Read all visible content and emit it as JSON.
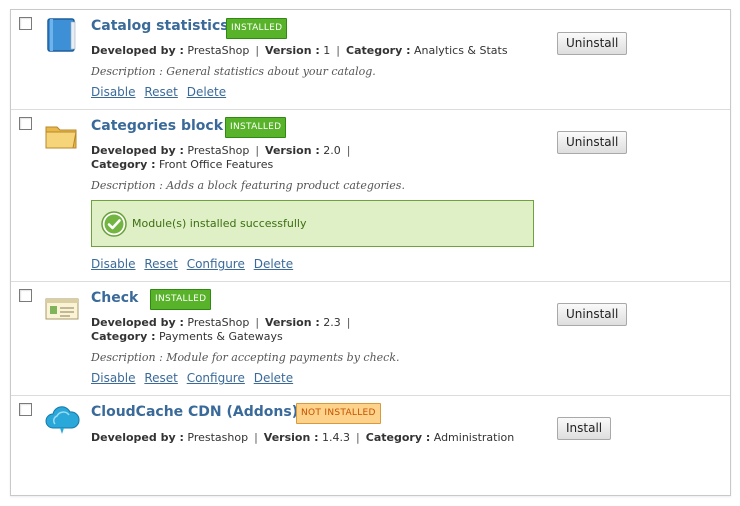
{
  "modules": [
    {
      "name": "Catalog statistics",
      "status": "INSTALLED",
      "developed_by_label": "Developed by :",
      "developer": "PrestaShop",
      "version_label": "Version :",
      "version": "1",
      "category_label": "Category :",
      "category": "Analytics & Stats",
      "description": "Description : General statistics about your catalog.",
      "actions": [
        "Disable",
        "Reset",
        "Delete"
      ],
      "button": "Uninstall",
      "icon": "blue-book-icon"
    },
    {
      "name": "Categories block",
      "status": "INSTALLED",
      "developed_by_label": "Developed by :",
      "developer": "PrestaShop",
      "version_label": "Version :",
      "version": "2.0",
      "category_label": "Category :",
      "category": "Front Office Features",
      "description": "Description : Adds a block featuring product categories.",
      "message": "Module(s) installed successfully",
      "actions": [
        "Disable",
        "Reset",
        "Configure",
        "Delete"
      ],
      "button": "Uninstall",
      "icon": "folder-icon"
    },
    {
      "name": "Check",
      "status": "INSTALLED",
      "developed_by_label": "Developed by :",
      "developer": "PrestaShop",
      "version_label": "Version :",
      "version": "2.3",
      "category_label": "Category :",
      "category": "Payments & Gateways",
      "description": "Description : Module for accepting payments by check.",
      "actions": [
        "Disable",
        "Reset",
        "Configure",
        "Delete"
      ],
      "button": "Uninstall",
      "icon": "check-cheque-icon"
    },
    {
      "name": "CloudCache CDN (Addons)",
      "status": "NOT INSTALLED",
      "developed_by_label": "Developed by :",
      "developer": "Prestashop",
      "version_label": "Version :",
      "version": "1.4.3",
      "category_label": "Category :",
      "category": "Administration",
      "button": "Install",
      "icon": "cloud-icon"
    }
  ],
  "separator": "|",
  "colors": {
    "link": "#3a6a99",
    "installed_badge": "#58b32a",
    "not_installed_badge": "#fdd28b",
    "success_bg": "#dff0c7"
  }
}
